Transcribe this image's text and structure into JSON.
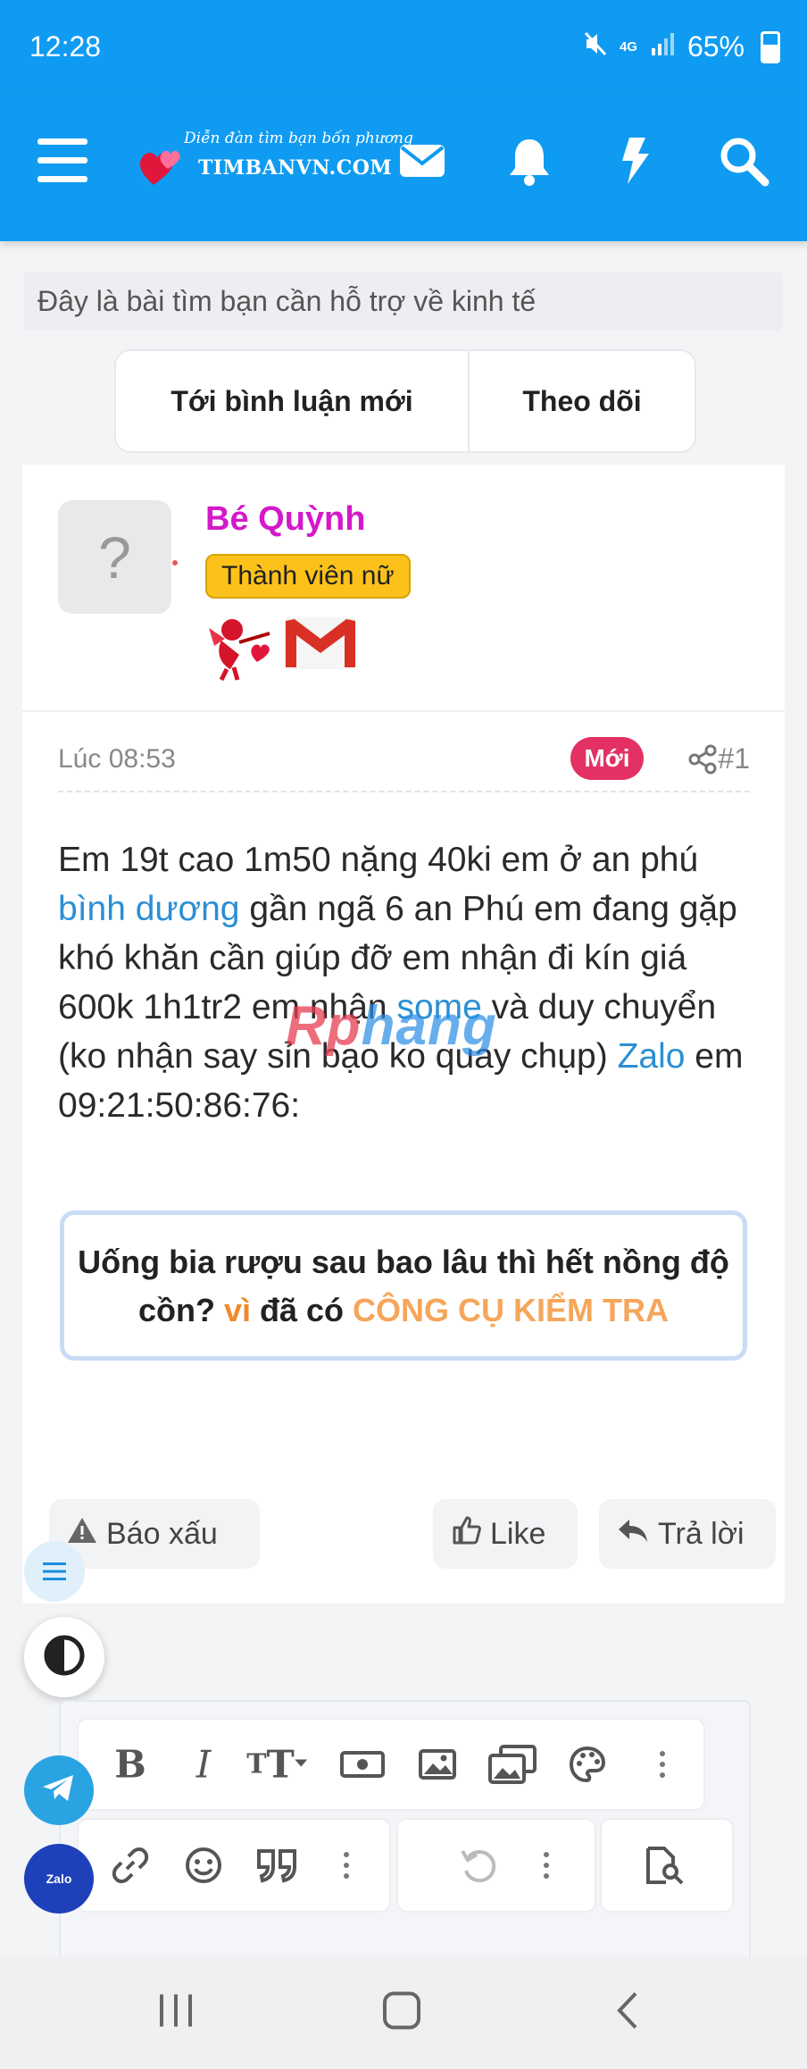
{
  "status": {
    "time": "12:28",
    "battery": "65%",
    "network": "4G"
  },
  "header": {
    "logo_tagline": "Diễn đàn tìm bạn bốn phương",
    "logo_name": "TIMBANVN.COM"
  },
  "thread": {
    "title": "Đây là bài tìm bạn cần hỗ trợ về kinh tế",
    "button_new_comment": "Tới bình luận mới",
    "button_follow": "Theo dõi"
  },
  "post": {
    "author": "Bé Quỳnh",
    "author_badge": "Thành viên nữ",
    "avatar_placeholder": "?",
    "time": "Lúc 08:53",
    "new_label": "Mới",
    "number": "#1",
    "body": {
      "part1": "Em 19t cao 1m50 nặng 40ki em ở an phú ",
      "link1": "bình dương",
      "part2": " gần ngã 6 an Phú em đang gặp khó khăn cần giúp đỡ em nhận đi kín giá 600k 1h1tr2 em nhận ",
      "link2": "some",
      "part3": " và duy chuyển (ko nhận say sỉn bạo ko quay chụp) ",
      "link3": "Zalo",
      "part4": " em 09:21:50:86:76:"
    },
    "watermark_red": "Rp",
    "watermark_blue": "hang"
  },
  "promo": {
    "text1": "Uống bia rượu sau bao lâu thì hết nồng độ cồn?",
    "text2": "vì",
    "text3": "đã có",
    "text4": "CÔNG CỤ KIỂM TRA"
  },
  "actions": {
    "report": "Báo xấu",
    "like": "Like",
    "reply": "Trả lời"
  },
  "fab": {
    "zalo": "Zalo"
  },
  "editor": {
    "bold": "B",
    "italic": "I",
    "text_size": "T"
  },
  "colors": {
    "brand_blue": "#0f9bf2",
    "username": "#d319c9",
    "badge": "#fcc21b",
    "new": "#e33163",
    "link": "#2a8fd4",
    "promo_orange": "#f08a2d"
  }
}
